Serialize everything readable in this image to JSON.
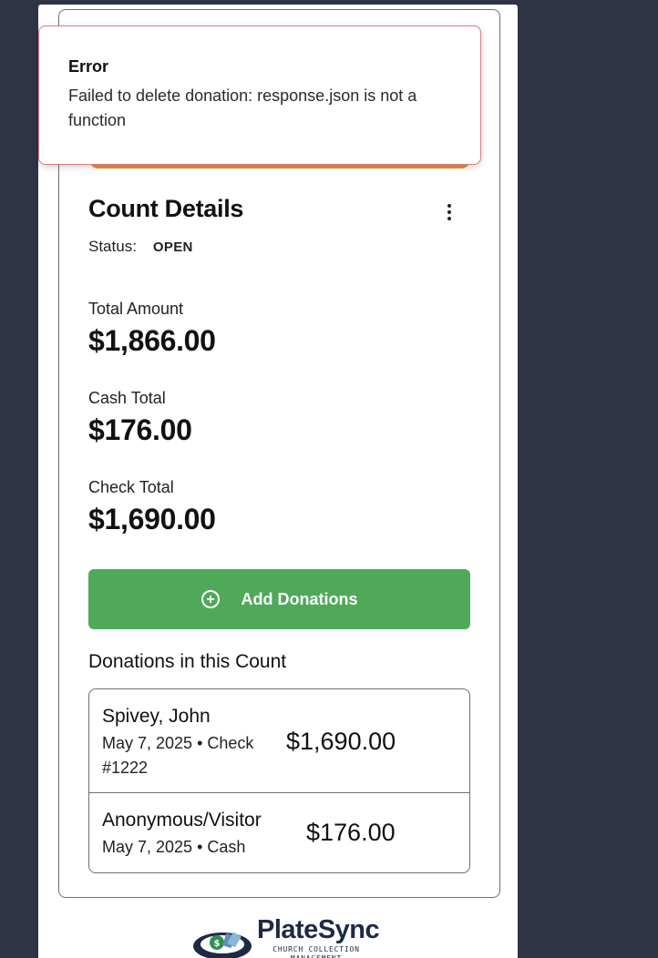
{
  "toast": {
    "title": "Error",
    "message": "Failed to delete donation: response.json is not a function"
  },
  "count": {
    "title": "Count Details",
    "status_label": "Status:",
    "status_value": "OPEN",
    "total_label": "Total Amount",
    "total_value": "$1,866.00",
    "cash_label": "Cash Total",
    "cash_value": "$176.00",
    "check_label": "Check Total",
    "check_value": "$1,690.00"
  },
  "actions": {
    "add_label": "Add Donations"
  },
  "donations": {
    "heading": "Donations in this Count",
    "items": [
      {
        "name": "Spivey, John",
        "meta": "May 7, 2025 • Check #1222",
        "amount": "$1,690.00"
      },
      {
        "name": "Anonymous/Visitor",
        "meta": "May 7, 2025 • Cash",
        "amount": "$176.00"
      }
    ]
  },
  "brand": {
    "name": "PlateSync",
    "tagline": "CHURCH COLLECTION MANAGEMENT",
    "colors": {
      "accent_green": "#4fa959",
      "warning_orange": "#e8903a",
      "error_border": "#e07a80",
      "background": "#2e3446"
    }
  }
}
